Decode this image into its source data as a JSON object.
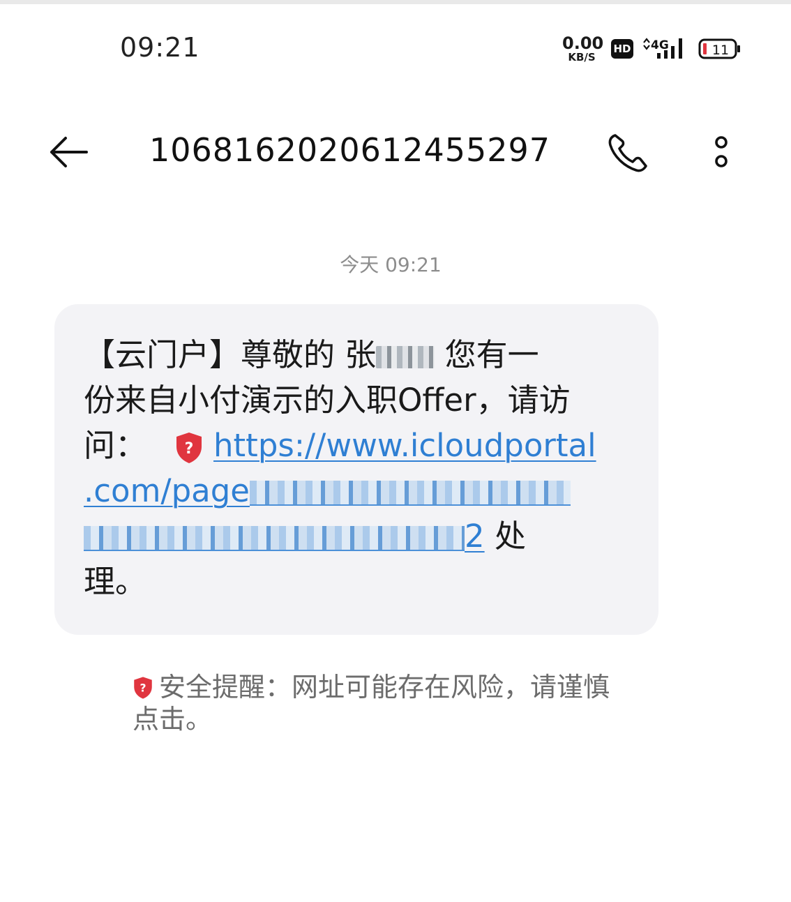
{
  "status_bar": {
    "time": "09:21",
    "net_speed_value": "0.00",
    "net_speed_unit": "KB/S",
    "hd_label": "HD",
    "network_label": "4G",
    "battery_level": "11"
  },
  "header": {
    "sender_number": "1068162020612455297",
    "back_icon": "back-arrow-icon",
    "call_icon": "phone-icon",
    "more_icon": "more-vertical-icon"
  },
  "conversation": {
    "date_separator": "今天 09:21"
  },
  "message": {
    "line1_prefix": "【云门户】尊敬的 张",
    "line1_suffix": " 您有一",
    "line2": "份来自小付演示的入职Offer，请访",
    "line3_prefix": "问：",
    "link_line1": "https://www.icloudportal",
    "link_line2_visible": ".com/page",
    "link_line3_visible": "2",
    "line3_after_link": " 处",
    "line4": "理。",
    "link_color": "#2f7fd3"
  },
  "security_warning": {
    "line1": "安全提醒：网址可能存在风险，请谨慎",
    "line2": "点击。",
    "shield_color": "#e0353f"
  }
}
